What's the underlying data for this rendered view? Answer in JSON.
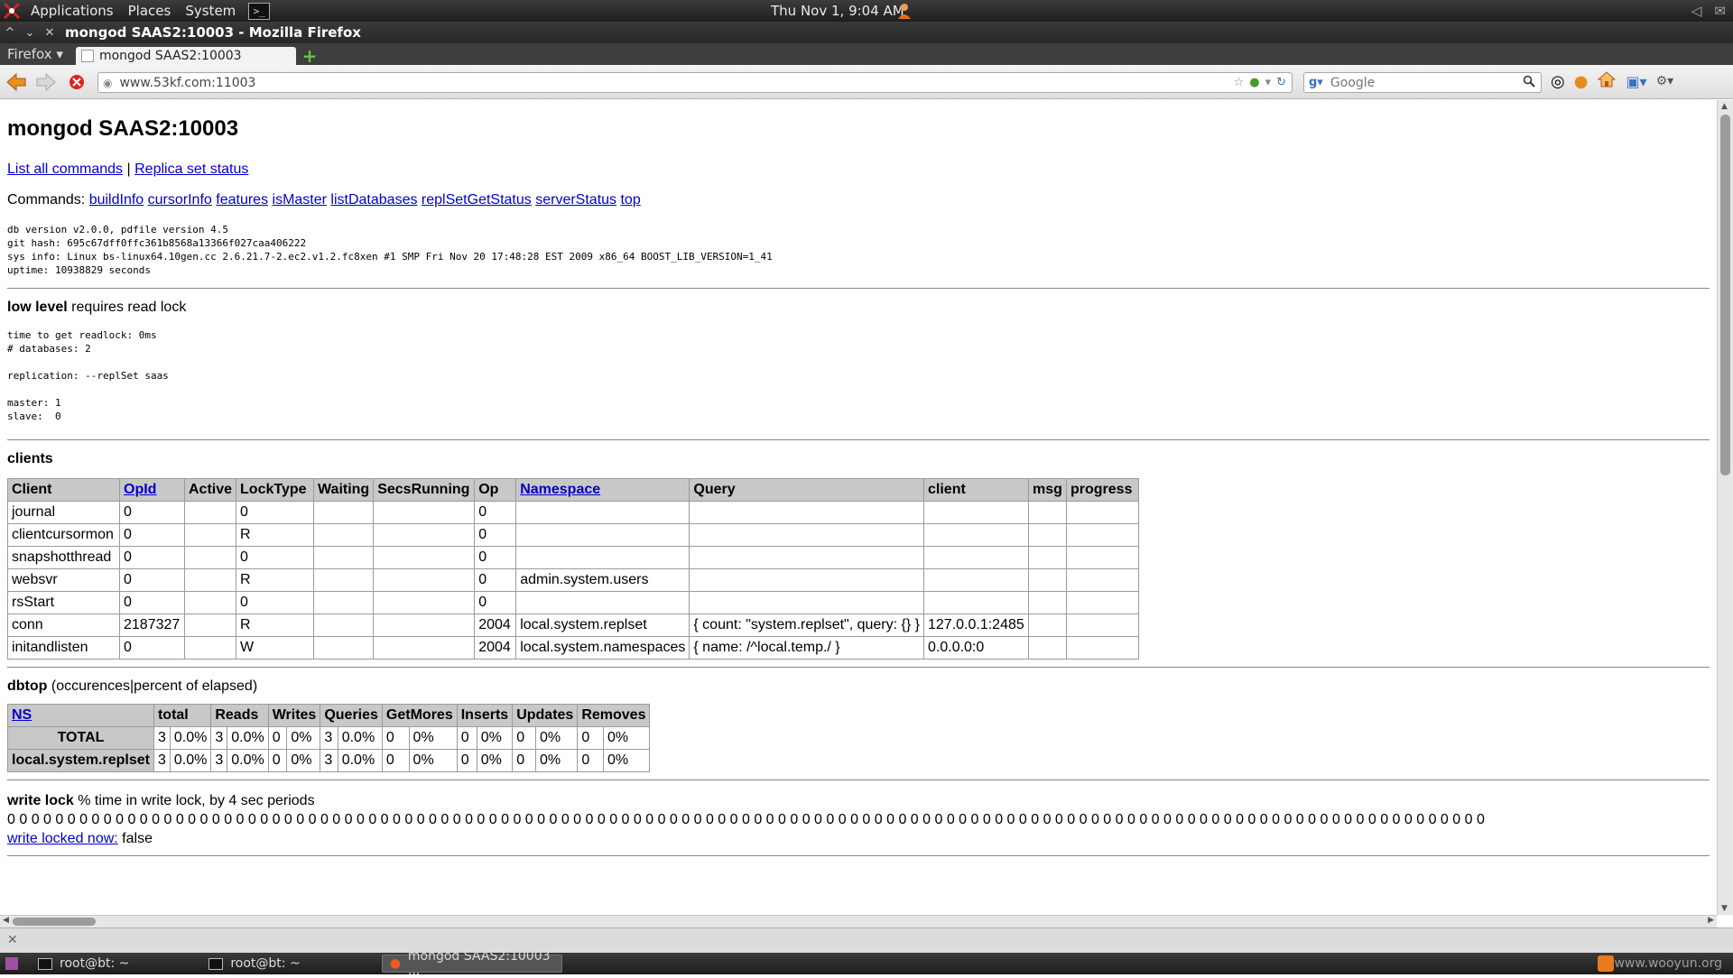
{
  "top_panel": {
    "menus": [
      "Applications",
      "Places",
      "System"
    ],
    "clock": "Thu Nov  1,  9:04 AM"
  },
  "window": {
    "title": "mongod SAAS2:10003 - Mozilla Firefox"
  },
  "tabbar": {
    "firefox_menu": "Firefox",
    "active_tab": "mongod SAAS2:10003"
  },
  "navbar": {
    "url": "www.53kf.com:11003",
    "search_engine": "Google",
    "search_placeholder": "Google"
  },
  "page": {
    "heading": "mongod SAAS2:10003",
    "links": {
      "list_all_commands": "List all commands",
      "separator": "|",
      "replica_set_status": "Replica set status"
    },
    "commands_label": "Commands:",
    "commands": [
      "buildInfo",
      "cursorInfo",
      "features",
      "isMaster",
      "listDatabases",
      "replSetGetStatus",
      "serverStatus",
      "top"
    ],
    "version_info": [
      "db version v2.0.0, pdfile version 4.5",
      "git hash: 695c67dff0ffc361b8568a13366f027caa406222",
      "sys info: Linux bs-linux64.10gen.cc 2.6.21.7-2.ec2.v1.2.fc8xen #1 SMP Fri Nov 20 17:48:28 EST 2009 x86_64 BOOST_LIB_VERSION=1_41",
      "uptime: 10938829 seconds"
    ],
    "low_level": {
      "title": "low level",
      "subtitle": " requires read lock",
      "lines": [
        "time to get readlock: 0ms",
        "# databases: 2",
        "",
        "replication: --replSet saas",
        "",
        "master: 1",
        "slave:  0"
      ]
    },
    "clients": {
      "title": "clients",
      "columns": [
        "Client",
        "OpId",
        "Active",
        "LockType",
        "Waiting",
        "SecsRunning",
        "Op",
        "Namespace",
        "Query",
        "client",
        "msg",
        "progress"
      ],
      "rows": [
        [
          "journal",
          "0",
          "",
          "0",
          "",
          "",
          "0",
          "",
          "",
          "",
          "",
          ""
        ],
        [
          "clientcursormon",
          "0",
          "",
          "R",
          "",
          "",
          "0",
          "",
          "",
          "",
          "",
          ""
        ],
        [
          "snapshotthread",
          "0",
          "",
          "0",
          "",
          "",
          "0",
          "",
          "",
          "",
          "",
          ""
        ],
        [
          "websvr",
          "0",
          "",
          "R",
          "",
          "",
          "0",
          "admin.system.users",
          "",
          "",
          "",
          ""
        ],
        [
          "rsStart",
          "0",
          "",
          "0",
          "",
          "",
          "0",
          "",
          "",
          "",
          "",
          ""
        ],
        [
          "conn",
          "2187327",
          "",
          "R",
          "",
          "",
          "2004",
          "local.system.replset",
          "{ count: \"system.replset\", query: {} }",
          "127.0.0.1:2485",
          "",
          ""
        ],
        [
          "initandlisten",
          "0",
          "",
          "W",
          "",
          "",
          "2004",
          "local.system.namespaces",
          "{ name: /^local.temp./ }",
          "0.0.0.0:0",
          "",
          ""
        ]
      ]
    },
    "dbtop": {
      "title": "dbtop",
      "subtitle": " (occurences|percent of elapsed)",
      "columns": [
        "NS",
        "total",
        "Reads",
        "Writes",
        "Queries",
        "GetMores",
        "Inserts",
        "Updates",
        "Removes"
      ],
      "rows": [
        {
          "ns": "TOTAL",
          "cells": [
            "3",
            "0.0%",
            "3",
            "0.0%",
            "0",
            "0%",
            "3",
            "0.0%",
            "0",
            "0%",
            "0",
            "0%",
            "0",
            "0%",
            "0",
            "0%"
          ]
        },
        {
          "ns": "local.system.replset",
          "cells": [
            "3",
            "0.0%",
            "3",
            "0.0%",
            "0",
            "0%",
            "3",
            "0.0%",
            "0",
            "0%",
            "0",
            "0%",
            "0",
            "0%",
            "0",
            "0%"
          ]
        }
      ]
    },
    "write_lock": {
      "title": "write lock",
      "subtitle": " % time in write lock, by 4 sec periods",
      "periods": "0 0 0 0 0 0 0 0 0 0 0 0 0 0 0 0 0 0 0 0 0 0 0 0 0 0 0 0 0 0 0 0 0 0 0 0 0 0 0 0 0 0 0 0 0 0 0 0 0 0 0 0 0 0 0 0 0 0 0 0 0 0 0 0 0 0 0 0 0 0 0 0 0 0 0 0 0 0 0 0 0 0 0 0 0 0 0 0 0 0 0 0 0 0 0 0 0 0 0 0 0 0 0 0 0 0 0 0 0 0 0 0 0 0 0 0 0 0 0 0 0 0 0",
      "locked_now_label": "write locked now:",
      "locked_now_value": " false"
    }
  },
  "taskbar": {
    "tasks": [
      "root@bt: ~",
      "root@bt: ~",
      "mongod SAAS2:10003 ..."
    ],
    "watermark": "www.wooyun.org"
  },
  "icons": {
    "back": "back-arrow-icon",
    "forward": "forward-arrow-icon",
    "stop": "stop-icon",
    "bookmark_star": "star-icon",
    "reload": "reload-icon",
    "search": "magnifier-icon",
    "home": "home-icon"
  }
}
